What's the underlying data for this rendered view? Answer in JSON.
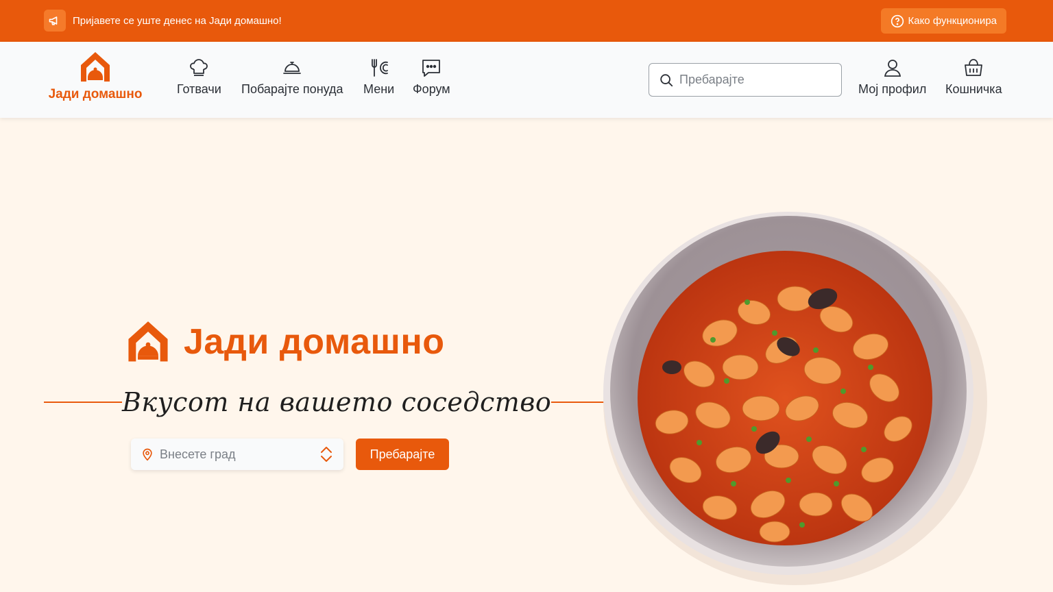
{
  "topbar": {
    "announcement": "Пријавете се уште денес на Јади домашно!",
    "how_it_works": "Како функционира"
  },
  "brand": {
    "name": "Јади домашно",
    "color": "#e8590c"
  },
  "nav": {
    "items": [
      {
        "label": "Готвачи",
        "icon": "chef-hat-icon"
      },
      {
        "label": "Побарајте понуда",
        "icon": "cloche-icon"
      },
      {
        "label": "Мени",
        "icon": "utensils-icon"
      },
      {
        "label": "Форум",
        "icon": "chat-icon"
      }
    ],
    "search_placeholder": "Пребарајте",
    "profile": "Мој профил",
    "cart": "Кошничка"
  },
  "hero": {
    "title": "Јади домашно",
    "tagline": "Вкусот на вашето соседство",
    "city_placeholder": "Внесете град",
    "search_button": "Пребарајте"
  },
  "image": {
    "subject": "bowl of baked beans in tomato sauce"
  }
}
